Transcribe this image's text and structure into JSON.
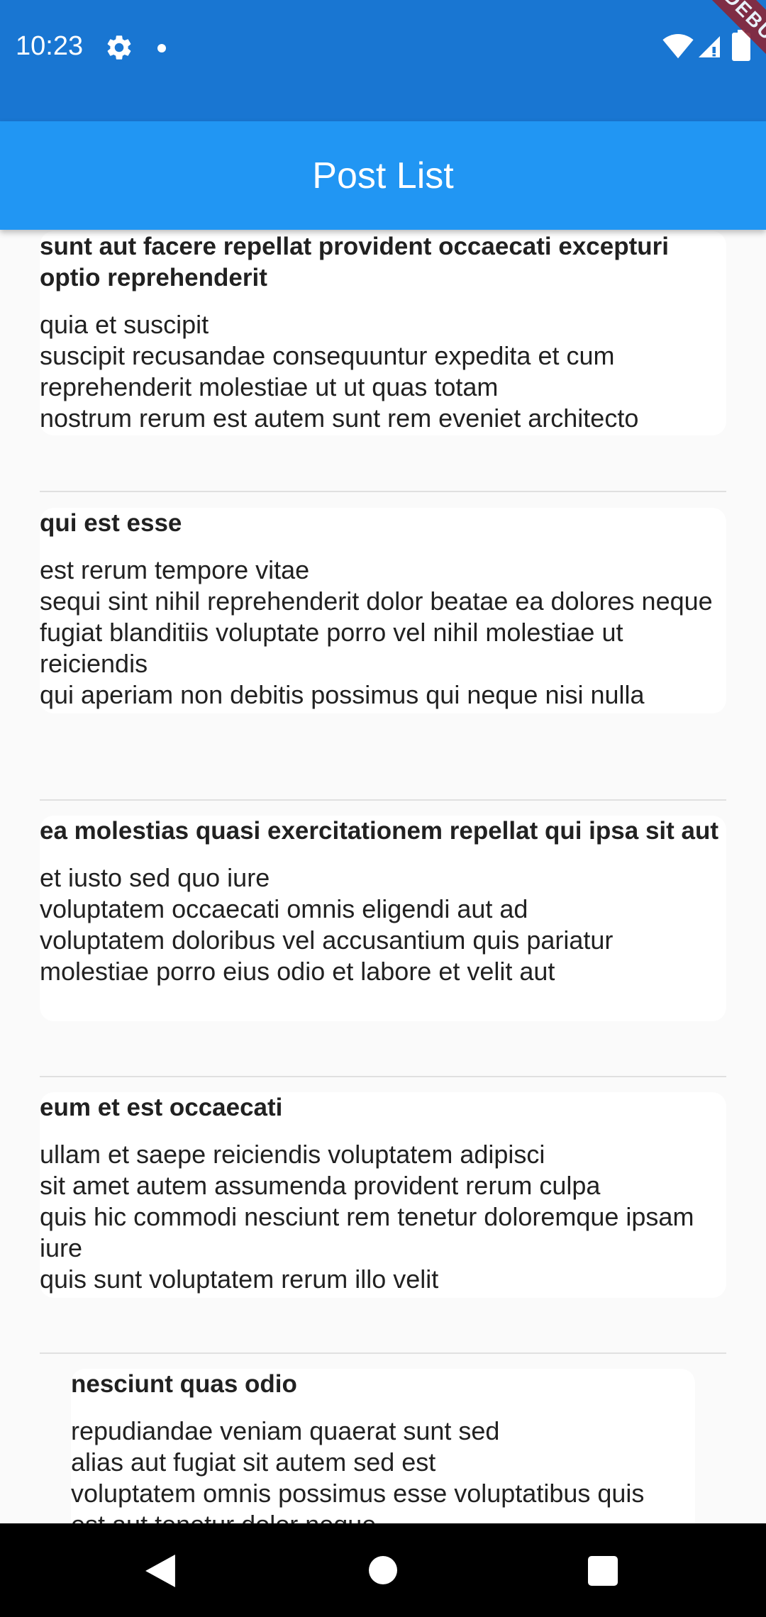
{
  "status_bar": {
    "time": "10:23",
    "icons": [
      "gear-icon",
      "notification-dot-icon",
      "wifi-icon",
      "signal-icon",
      "battery-icon"
    ],
    "color": "#1976d2"
  },
  "debug_banner": "DEBUG",
  "app_bar": {
    "title": "Post List",
    "color": "#2196f3"
  },
  "posts": [
    {
      "title": "sunt aut facere repellat provident occaecati excepturi optio reprehenderit",
      "body": "quia et suscipit\nsuscipit recusandae consequuntur expedita et cum reprehenderit molestiae ut ut quas totam\nnostrum rerum est autem sunt rem eveniet architecto"
    },
    {
      "title": "qui est esse",
      "body": "est rerum tempore vitae\nsequi sint nihil reprehenderit dolor beatae ea dolores neque\nfugiat blanditiis voluptate porro vel nihil molestiae ut reiciendis\nqui aperiam non debitis possimus qui neque nisi nulla"
    },
    {
      "title": "ea molestias quasi exercitationem repellat qui ipsa sit aut",
      "body": "et iusto sed quo iure\nvoluptatem occaecati omnis eligendi aut ad\nvoluptatem doloribus vel accusantium quis pariatur\nmolestiae porro eius odio et labore et velit aut"
    },
    {
      "title": "eum et est occaecati",
      "body": "ullam et saepe reiciendis voluptatem adipisci\nsit amet autem assumenda provident rerum culpa\nquis hic commodi nesciunt rem tenetur doloremque ipsam iure\nquis sunt voluptatem rerum illo velit"
    },
    {
      "title": "nesciunt quas odio",
      "body": "repudiandae veniam quaerat sunt sed\nalias aut fugiat sit autem sed est\nvoluptatem omnis possimus esse voluptatibus quis\nest aut tenetur dolor neque"
    }
  ],
  "nav_bar": {
    "icons": [
      "back-icon",
      "home-icon",
      "recents-icon"
    ]
  }
}
